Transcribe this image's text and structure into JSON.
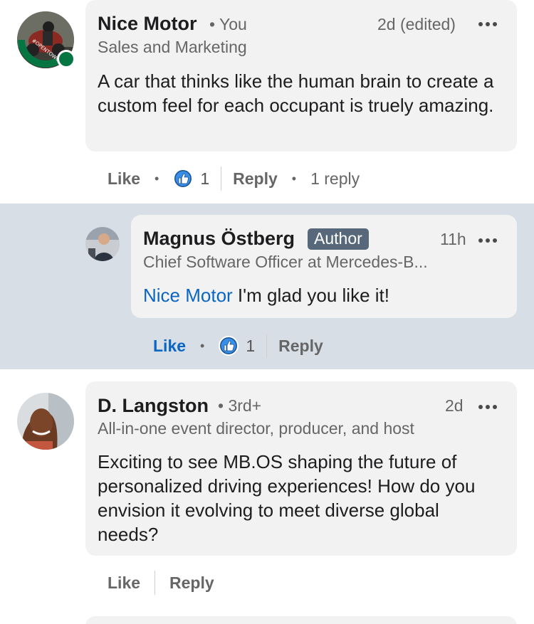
{
  "comments": [
    {
      "name": "Nice Motor",
      "relation": "• You",
      "headline": "Sales and Marketing",
      "time": "2d (edited)",
      "text": "A car that thinks like the human brain to create a custom feel for each occupant is truely amazing.",
      "actions": {
        "like": "Like",
        "reaction_count": "1",
        "reply": "Reply",
        "replies": "1 reply"
      },
      "avatar_badge": "#OPENTOWORK"
    },
    {
      "name": "D. Langston",
      "relation": "• 3rd+",
      "headline": "All-in-one event director, producer, and host",
      "time": "2d",
      "text": "Exciting to see MB.OS shaping the future of personalized driving experiences! How do you envision it evolving to meet diverse global needs?",
      "actions": {
        "like": "Like",
        "reply": "Reply"
      }
    }
  ],
  "reply": {
    "name": "Magnus Östberg",
    "badge": "Author",
    "headline": "Chief Software Officer at Mercedes-B...",
    "time": "11h",
    "mention": "Nice Motor",
    "text": " I'm glad you like it!",
    "actions": {
      "like": "Like",
      "reaction_count": "1",
      "reply": "Reply"
    }
  },
  "colors": {
    "link_blue": "#0a66c2",
    "reaction_blue": "#378fe9",
    "open_to_work_green": "#057642",
    "highlight_band": "#d8dee5",
    "bubble": "#f2f2f2"
  }
}
